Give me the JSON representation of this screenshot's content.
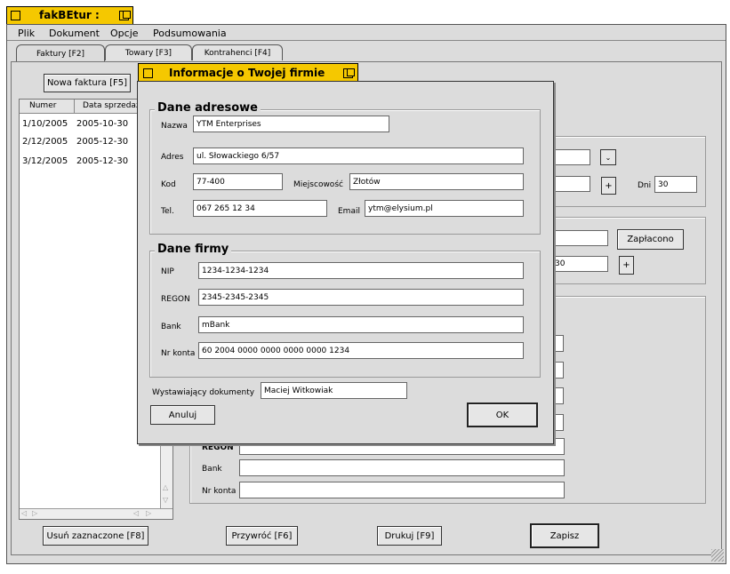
{
  "app": {
    "title": "fakBEtur :"
  },
  "menu": [
    "Plik",
    "Dokument",
    "Opcje",
    "Podsumowania"
  ],
  "tabs": [
    "Faktury [F2]",
    "Towary [F3]",
    "Kontrahenci [F4]"
  ],
  "left": {
    "new_invoice": "Nowa faktura [F5]",
    "columns": [
      "Numer",
      "Data sprzedaż"
    ],
    "rows": [
      {
        "num": "1/10/2005",
        "date": "2005-10-30"
      },
      {
        "num": "2/12/2005",
        "date": "2005-12-30"
      },
      {
        "num": "3/12/2005",
        "date": "2005-12-30"
      }
    ]
  },
  "background": {
    "dni_label": "Dni",
    "dni_value": "30",
    "paid_button": "Zapłacono",
    "plus": "+",
    "days_value2": "30",
    "regon_label": "REGON",
    "bank_label": "Bank",
    "account_label": "Nr konta"
  },
  "bottom": {
    "delete": "Usuń zaznaczone [F8]",
    "restore": "Przywróć [F6]",
    "print": "Drukuj [F9]",
    "save": "Zapisz"
  },
  "dialog": {
    "title": "Informacje o Twojej firmie",
    "address_group": "Dane adresowe",
    "name_label": "Nazwa",
    "name_value": "YTM Enterprises",
    "address_label": "Adres",
    "address_value": "ul. Słowackiego 6/57",
    "code_label": "Kod",
    "code_value": "77-400",
    "city_label": "Miejscowość",
    "city_value": "Złotów",
    "phone_label": "Tel.",
    "phone_value": "067 265 12 34",
    "email_label": "Email",
    "email_value": "ytm@elysium.pl",
    "company_group": "Dane firmy",
    "nip_label": "NIP",
    "nip_value": "1234-1234-1234",
    "regon_label": "REGON",
    "regon_value": "2345-2345-2345",
    "bank_label": "Bank",
    "bank_value": "mBank",
    "account_label": "Nr konta",
    "account_value": "60 2004 0000 0000 0000 0000 1234",
    "issuer_label": "Wystawiający dokumenty",
    "issuer_value": "Maciej Witkowiak",
    "cancel": "Anuluj",
    "ok": "OK"
  }
}
